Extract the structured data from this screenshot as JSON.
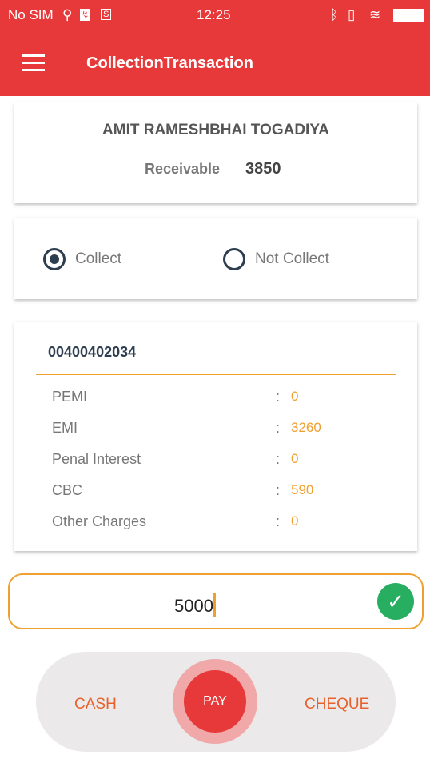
{
  "status_bar": {
    "carrier": "No SIM",
    "time": "12:25",
    "icons": [
      "usb-icon",
      "app-icon",
      "s-icon",
      "bluetooth-icon",
      "vibrate-icon",
      "wifi-icon",
      "battery-icon"
    ]
  },
  "app_bar": {
    "title": "CollectionTransaction",
    "menu_icon": "hamburger-icon"
  },
  "customer": {
    "name": "AMIT RAMESHBHAI TOGADIYA",
    "receivable_label": "Receivable",
    "receivable_value": "3850"
  },
  "collect_options": [
    {
      "label": "Collect",
      "selected": true
    },
    {
      "label": "Not Collect",
      "selected": false
    }
  ],
  "account": {
    "number": "00400402034",
    "rows": [
      {
        "label": "PEMI",
        "value": "0"
      },
      {
        "label": "EMI",
        "value": "3260"
      },
      {
        "label": "Penal Interest",
        "value": "0"
      },
      {
        "label": "CBC",
        "value": "590"
      },
      {
        "label": "Other Charges",
        "value": "0"
      }
    ],
    "separator": ":"
  },
  "amount_input": {
    "value": "5000"
  },
  "payment": {
    "cash": "CASH",
    "pay": "PAY",
    "cheque": "CHEQUE"
  },
  "colors": {
    "primary": "#e8393a",
    "accent": "#f0a030",
    "dark": "#2c3e50",
    "success": "#27ae60"
  }
}
